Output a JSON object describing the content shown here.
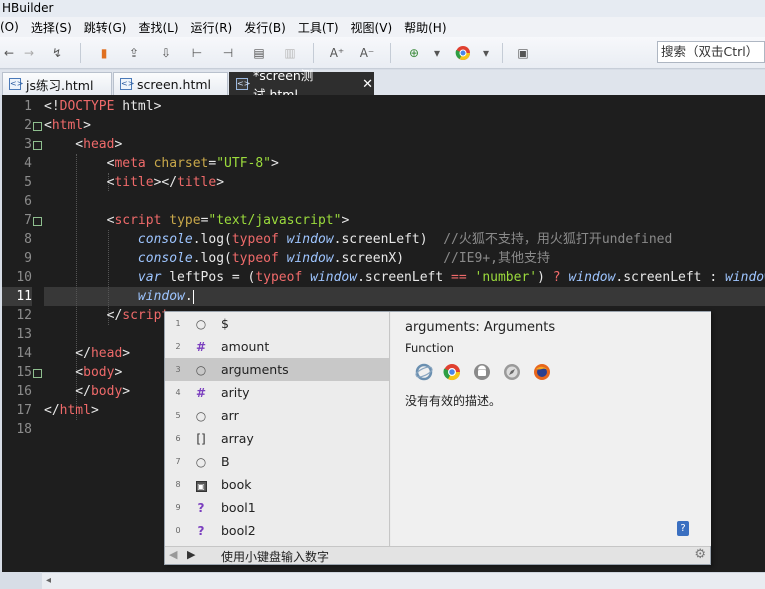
{
  "window": {
    "title": "HBuilder"
  },
  "menu": [
    "(O)",
    "选择(S)",
    "跳转(G)",
    "查找(L)",
    "运行(R)",
    "发行(B)",
    "工具(T)",
    "视图(V)",
    "帮助(H)"
  ],
  "search": {
    "placeholder": "搜索（双击Ctrl）"
  },
  "tabs": [
    {
      "label": "js练习.html",
      "active": false
    },
    {
      "label": "screen.html",
      "active": false
    },
    {
      "label": "*screen测试.html",
      "active": true,
      "close": "✕"
    }
  ],
  "editor": {
    "line_numbers": [
      "1",
      "2",
      "3",
      "4",
      "5",
      "6",
      "7",
      "8",
      "9",
      "10",
      "11",
      "12",
      "13",
      "14",
      "15",
      "16",
      "17",
      "18"
    ],
    "current_line": "11"
  },
  "autocomplete": {
    "items": [
      {
        "num": "1",
        "kind": "○",
        "label": "$"
      },
      {
        "num": "2",
        "kind": "#",
        "label": "amount"
      },
      {
        "num": "3",
        "kind": "○",
        "label": "arguments",
        "selected": true
      },
      {
        "num": "4",
        "kind": "#",
        "label": "arity"
      },
      {
        "num": "5",
        "kind": "○",
        "label": "arr"
      },
      {
        "num": "6",
        "kind": "[]",
        "label": "array"
      },
      {
        "num": "7",
        "kind": "○",
        "label": "B"
      },
      {
        "num": "8",
        "kind": "▣",
        "label": "book"
      },
      {
        "num": "9",
        "kind": "?",
        "label": "bool1"
      },
      {
        "num": "0",
        "kind": "?",
        "label": "bool2"
      }
    ],
    "detail_title": "arguments: Arguments",
    "detail_type": "Function",
    "detail_text": "没有有效的描述。",
    "browsers": [
      "ie-icon",
      "chrome-icon",
      "android-icon",
      "safari-icon",
      "firefox-icon"
    ],
    "footer_hint": "使用小键盘输入数字"
  },
  "colors": {
    "editor_bg": "#1e1e1e",
    "tag": "#ef6a6a",
    "attr": "#c9a84a",
    "string": "#9bdb3c",
    "object": "#9ec5ff",
    "comment": "#8a8a8a"
  }
}
